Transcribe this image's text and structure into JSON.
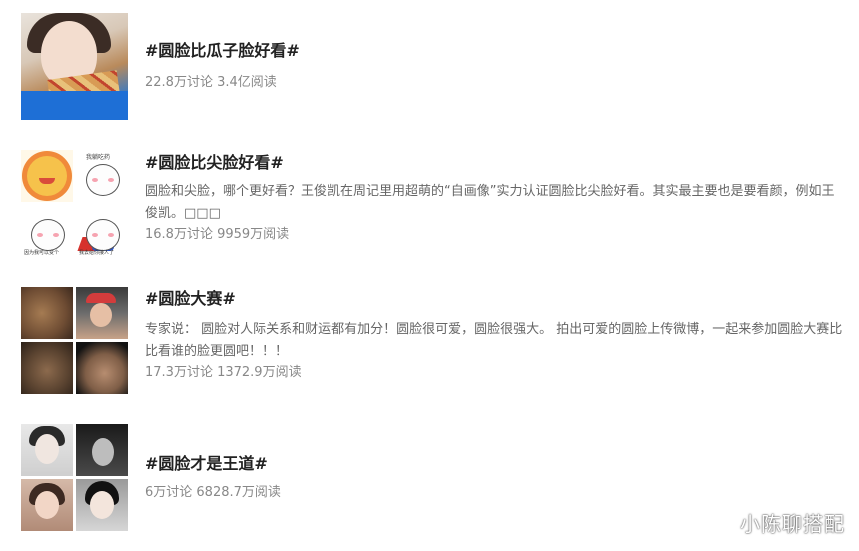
{
  "topics": [
    {
      "title": "#圆脸比瓜子脸好看#",
      "stats": "22.8万讨论 3.4亿阅读"
    },
    {
      "title": "#圆脸比尖脸好看#",
      "description": "圆脸和尖脸，哪个更好看？王俊凯在周记里用超萌的“自画像”实力认证圆脸比尖脸好看。其实最主要也是要看颜，例如王俊凯。□□□",
      "stats": "16.8万讨论 9959万阅读",
      "thumb_texts": {
        "top_right": "我躺吃药",
        "bottom_left": "因为我可以变个",
        "bottom_right": "我去给你接人了"
      }
    },
    {
      "title": "#圆脸大赛#",
      "description": "专家说： 圆脸对人际关系和财运都有加分！圆脸很可爱，圆脸很强大。 拍出可爱的圆脸上传微博，一起来参加圆脸大赛比比看谁的脸更圆吧！！！",
      "stats": "17.3万讨论 1372.9万阅读"
    },
    {
      "title": "#圆脸才是王道#",
      "stats": "6万讨论 6828.7万阅读"
    }
  ],
  "watermark": "小陈聊搭配"
}
